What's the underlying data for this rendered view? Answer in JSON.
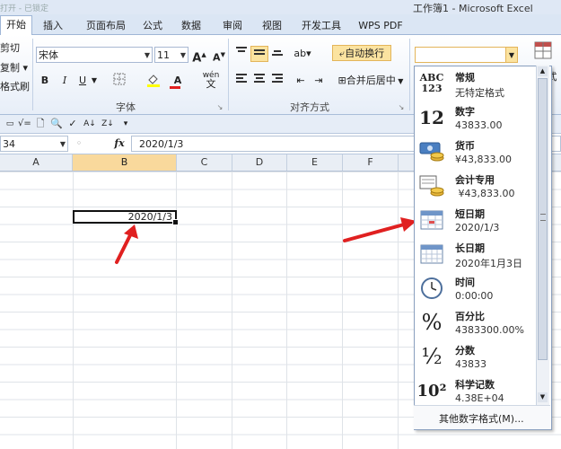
{
  "window": {
    "title": "工作簿1 - Microsoft Excel",
    "left_faint": "打开 - 已锁定"
  },
  "tabs": [
    "开始",
    "插入",
    "页面布局",
    "公式",
    "数据",
    "审阅",
    "视图",
    "开发工具",
    "WPS PDF"
  ],
  "clipboard": {
    "cut": "剪切",
    "copy": "复制 ▾",
    "format_painter": "格式刷"
  },
  "font": {
    "name": "宋体",
    "size": "11",
    "grow": "A",
    "shrink": "A",
    "bold": "B",
    "italic": "I",
    "underline": "U",
    "group_label": "字体",
    "wen": "wén"
  },
  "alignment": {
    "wrap_text": "自动换行",
    "merge_center": "合并后居中",
    "group_label": "对齐方式"
  },
  "number": {
    "format_value": "",
    "partial_label": "式"
  },
  "formula_bar": {
    "name_box": "34",
    "fx": "fx",
    "content": "2020/1/3"
  },
  "columns": [
    "A",
    "B",
    "C",
    "D",
    "E",
    "F"
  ],
  "cell": {
    "value": "2020/1/3"
  },
  "formats": [
    {
      "name": "常规",
      "example": "无特定格式",
      "icon": "abc-123-icon",
      "icon_text": "ABC 123"
    },
    {
      "name": "数字",
      "example": "43833.00",
      "icon": "number-12-icon",
      "icon_text": "12"
    },
    {
      "name": "货币",
      "example": "¥43,833.00",
      "icon": "currency-icon"
    },
    {
      "name": "会计专用",
      "example": " ¥43,833.00",
      "icon": "accounting-icon"
    },
    {
      "name": "短日期",
      "example": "2020/1/3",
      "icon": "calendar-icon"
    },
    {
      "name": "长日期",
      "example": "2020年1月3日",
      "icon": "calendar-icon"
    },
    {
      "name": "时间",
      "example": "0:00:00",
      "icon": "clock-icon"
    },
    {
      "name": "百分比",
      "example": "4383300.00%",
      "icon": "percent-icon",
      "icon_text": "%"
    },
    {
      "name": "分数",
      "example": "43833",
      "icon": "fraction-icon",
      "icon_text": "½"
    },
    {
      "name": "科学记数",
      "example": "4.38E+04",
      "icon": "scientific-icon",
      "icon_text": "10²"
    }
  ],
  "more_formats": "其他数字格式(M)...",
  "colors": {
    "arrow": "#e02020",
    "selected_col": "#f9d99c",
    "highlight": "#fbe3a0"
  }
}
